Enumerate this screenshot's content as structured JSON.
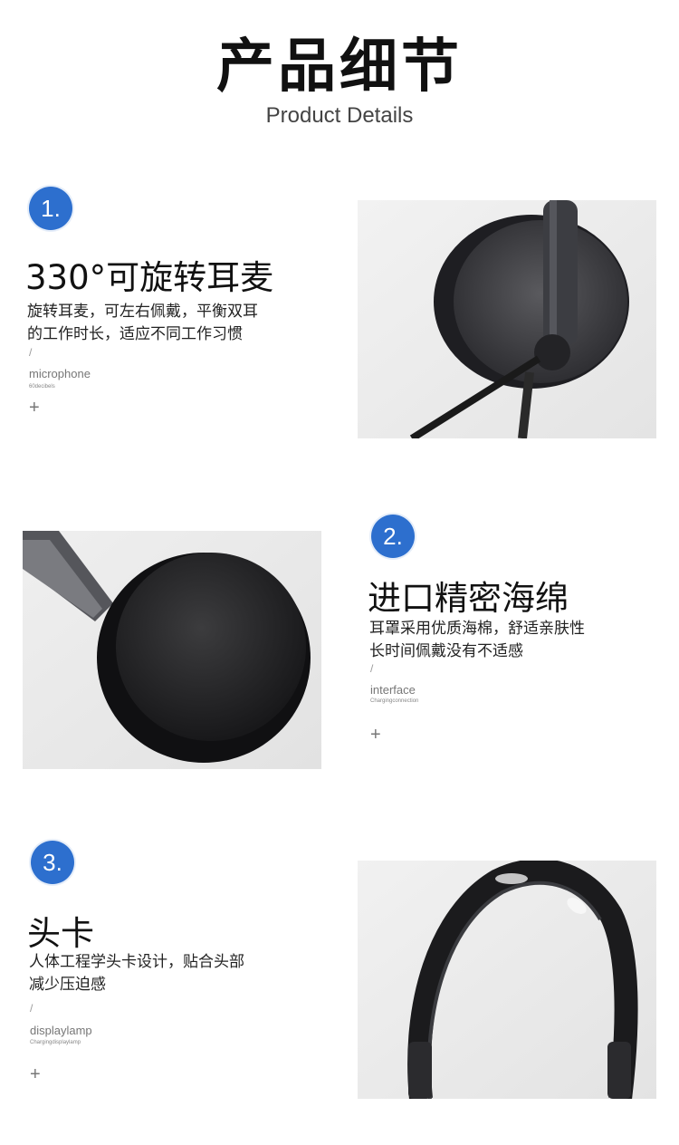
{
  "header": {
    "title": "产品细节",
    "subtitle": "Product Details"
  },
  "features": [
    {
      "number": "1.",
      "heading": "330°可旋转耳麦",
      "desc_line1": "旋转耳麦，可左右佩戴，平衡双耳",
      "desc_line2": "的工作时长，适应不同工作习惯",
      "slash": "/",
      "en_label": "microphone",
      "en_small": "60decibels",
      "plus": "+",
      "photo_icon": "rotating-mic-earcup-photo"
    },
    {
      "number": "2.",
      "heading": "进口精密海绵",
      "desc_line1": "耳罩采用优质海棉，舒适亲肤性",
      "desc_line2": "长时间佩戴没有不适感",
      "slash": "/",
      "en_label": "interface",
      "en_small": "Chargingconnection",
      "plus": "+",
      "photo_icon": "foam-earcup-photo"
    },
    {
      "number": "3.",
      "heading": "头卡",
      "desc_line1": "人体工程学头卡设计，贴合头部",
      "desc_line2": "减少压迫感",
      "slash": "/",
      "en_label": "displaylamp",
      "en_small": "Chargingdisplaylamp",
      "plus": "+",
      "photo_icon": "headband-photo"
    }
  ],
  "colors": {
    "badge": "#2d6fce",
    "text": "#111111",
    "photo_bg": "#ececec"
  }
}
